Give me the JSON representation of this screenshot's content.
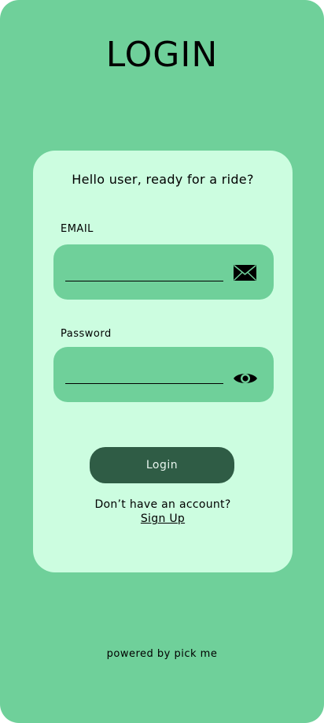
{
  "page": {
    "title": "LOGIN",
    "background_color": "#6fd09a"
  },
  "card": {
    "greeting": "Hello user, ready for a ride?",
    "background_color": "#ccfde0"
  },
  "email": {
    "label": "EMAIL",
    "value": "",
    "icon": "envelope-icon"
  },
  "password": {
    "label": "Password",
    "value": "",
    "icon": "eye-icon"
  },
  "actions": {
    "login_label": "Login",
    "login_color": "#2f5c45",
    "no_account_text": "Don’t have an account?",
    "signup_label": "Sign Up"
  },
  "footer": {
    "text": "powered by pick me"
  }
}
